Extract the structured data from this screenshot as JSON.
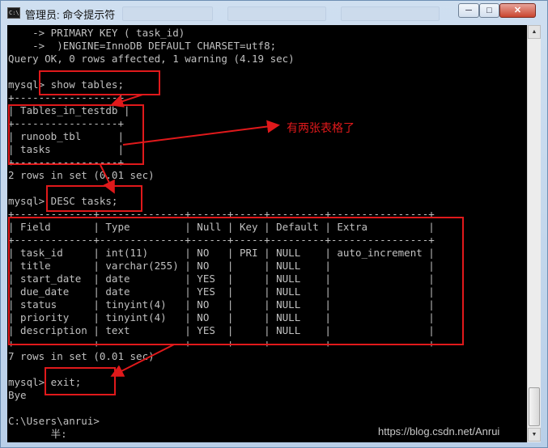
{
  "window": {
    "title": "管理员: 命令提示符",
    "icon_label": "C:\\.",
    "buttons": {
      "minimize": "─",
      "maximize": "□",
      "close": "✕"
    }
  },
  "console": {
    "lines": [
      "    -> PRIMARY KEY ( task_id)",
      "    ->  )ENGINE=InnoDB DEFAULT CHARSET=utf8;",
      "Query OK, 0 rows affected, 1 warning (4.19 sec)",
      "",
      "mysql> show tables;",
      "+-----------------+",
      "| Tables_in_testdb |",
      "+-----------------+",
      "| runoob_tbl      |",
      "| tasks           |",
      "+-----------------+",
      "2 rows in set (0.01 sec)",
      "",
      "mysql> DESC tasks;",
      "+-------------+--------------+------+-----+---------+----------------+",
      "| Field       | Type         | Null | Key | Default | Extra          |",
      "+-------------+--------------+------+-----+---------+----------------+",
      "| task_id     | int(11)      | NO   | PRI | NULL    | auto_increment |",
      "| title       | varchar(255) | NO   |     | NULL    |                |",
      "| start_date  | date         | YES  |     | NULL    |                |",
      "| due_date    | date         | YES  |     | NULL    |                |",
      "| status      | tinyint(4)   | NO   |     | NULL    |                |",
      "| priority    | tinyint(4)   | NO   |     | NULL    |                |",
      "| description | text         | YES  |     | NULL    |                |",
      "+-------------+--------------+------+-----+---------+----------------+",
      "7 rows in set (0.01 sec)",
      "",
      "mysql> exit;",
      "Bye",
      "",
      "C:\\Users\\anrui>",
      "       半:"
    ]
  },
  "annotation": {
    "text": "有两张表格了",
    "color": "#e0191b"
  },
  "watermark": "https://blog.csdn.net/Anrui"
}
